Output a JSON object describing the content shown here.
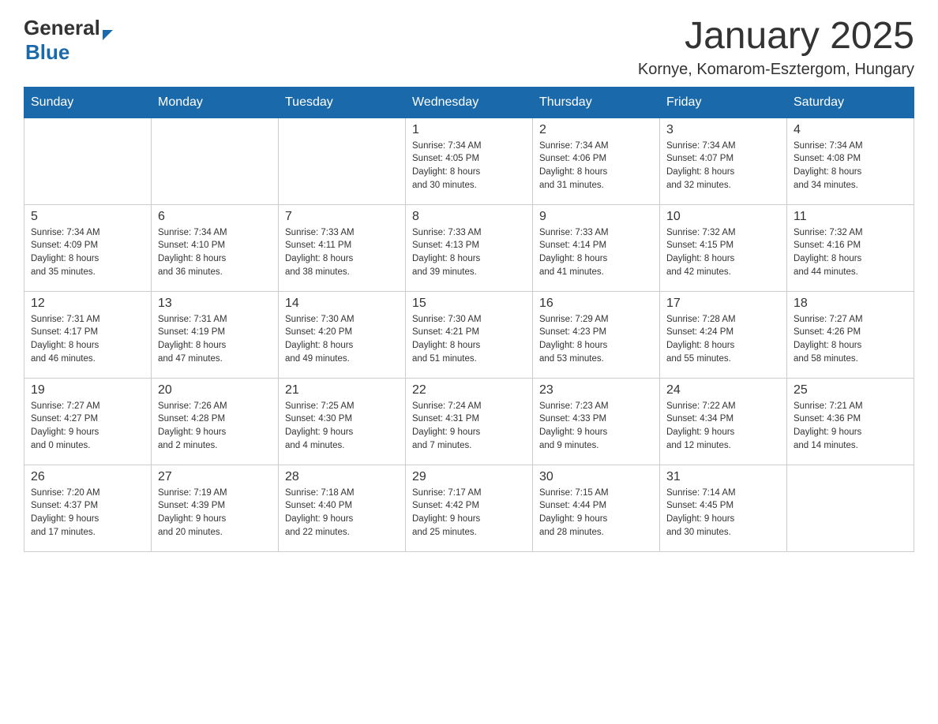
{
  "logo": {
    "general": "General",
    "blue": "Blue",
    "arrow_shape": "►"
  },
  "header": {
    "title": "January 2025",
    "subtitle": "Kornye, Komarom-Esztergom, Hungary"
  },
  "weekdays": [
    "Sunday",
    "Monday",
    "Tuesday",
    "Wednesday",
    "Thursday",
    "Friday",
    "Saturday"
  ],
  "weeks": [
    [
      {
        "day": "",
        "info": ""
      },
      {
        "day": "",
        "info": ""
      },
      {
        "day": "",
        "info": ""
      },
      {
        "day": "1",
        "info": "Sunrise: 7:34 AM\nSunset: 4:05 PM\nDaylight: 8 hours\nand 30 minutes."
      },
      {
        "day": "2",
        "info": "Sunrise: 7:34 AM\nSunset: 4:06 PM\nDaylight: 8 hours\nand 31 minutes."
      },
      {
        "day": "3",
        "info": "Sunrise: 7:34 AM\nSunset: 4:07 PM\nDaylight: 8 hours\nand 32 minutes."
      },
      {
        "day": "4",
        "info": "Sunrise: 7:34 AM\nSunset: 4:08 PM\nDaylight: 8 hours\nand 34 minutes."
      }
    ],
    [
      {
        "day": "5",
        "info": "Sunrise: 7:34 AM\nSunset: 4:09 PM\nDaylight: 8 hours\nand 35 minutes."
      },
      {
        "day": "6",
        "info": "Sunrise: 7:34 AM\nSunset: 4:10 PM\nDaylight: 8 hours\nand 36 minutes."
      },
      {
        "day": "7",
        "info": "Sunrise: 7:33 AM\nSunset: 4:11 PM\nDaylight: 8 hours\nand 38 minutes."
      },
      {
        "day": "8",
        "info": "Sunrise: 7:33 AM\nSunset: 4:13 PM\nDaylight: 8 hours\nand 39 minutes."
      },
      {
        "day": "9",
        "info": "Sunrise: 7:33 AM\nSunset: 4:14 PM\nDaylight: 8 hours\nand 41 minutes."
      },
      {
        "day": "10",
        "info": "Sunrise: 7:32 AM\nSunset: 4:15 PM\nDaylight: 8 hours\nand 42 minutes."
      },
      {
        "day": "11",
        "info": "Sunrise: 7:32 AM\nSunset: 4:16 PM\nDaylight: 8 hours\nand 44 minutes."
      }
    ],
    [
      {
        "day": "12",
        "info": "Sunrise: 7:31 AM\nSunset: 4:17 PM\nDaylight: 8 hours\nand 46 minutes."
      },
      {
        "day": "13",
        "info": "Sunrise: 7:31 AM\nSunset: 4:19 PM\nDaylight: 8 hours\nand 47 minutes."
      },
      {
        "day": "14",
        "info": "Sunrise: 7:30 AM\nSunset: 4:20 PM\nDaylight: 8 hours\nand 49 minutes."
      },
      {
        "day": "15",
        "info": "Sunrise: 7:30 AM\nSunset: 4:21 PM\nDaylight: 8 hours\nand 51 minutes."
      },
      {
        "day": "16",
        "info": "Sunrise: 7:29 AM\nSunset: 4:23 PM\nDaylight: 8 hours\nand 53 minutes."
      },
      {
        "day": "17",
        "info": "Sunrise: 7:28 AM\nSunset: 4:24 PM\nDaylight: 8 hours\nand 55 minutes."
      },
      {
        "day": "18",
        "info": "Sunrise: 7:27 AM\nSunset: 4:26 PM\nDaylight: 8 hours\nand 58 minutes."
      }
    ],
    [
      {
        "day": "19",
        "info": "Sunrise: 7:27 AM\nSunset: 4:27 PM\nDaylight: 9 hours\nand 0 minutes."
      },
      {
        "day": "20",
        "info": "Sunrise: 7:26 AM\nSunset: 4:28 PM\nDaylight: 9 hours\nand 2 minutes."
      },
      {
        "day": "21",
        "info": "Sunrise: 7:25 AM\nSunset: 4:30 PM\nDaylight: 9 hours\nand 4 minutes."
      },
      {
        "day": "22",
        "info": "Sunrise: 7:24 AM\nSunset: 4:31 PM\nDaylight: 9 hours\nand 7 minutes."
      },
      {
        "day": "23",
        "info": "Sunrise: 7:23 AM\nSunset: 4:33 PM\nDaylight: 9 hours\nand 9 minutes."
      },
      {
        "day": "24",
        "info": "Sunrise: 7:22 AM\nSunset: 4:34 PM\nDaylight: 9 hours\nand 12 minutes."
      },
      {
        "day": "25",
        "info": "Sunrise: 7:21 AM\nSunset: 4:36 PM\nDaylight: 9 hours\nand 14 minutes."
      }
    ],
    [
      {
        "day": "26",
        "info": "Sunrise: 7:20 AM\nSunset: 4:37 PM\nDaylight: 9 hours\nand 17 minutes."
      },
      {
        "day": "27",
        "info": "Sunrise: 7:19 AM\nSunset: 4:39 PM\nDaylight: 9 hours\nand 20 minutes."
      },
      {
        "day": "28",
        "info": "Sunrise: 7:18 AM\nSunset: 4:40 PM\nDaylight: 9 hours\nand 22 minutes."
      },
      {
        "day": "29",
        "info": "Sunrise: 7:17 AM\nSunset: 4:42 PM\nDaylight: 9 hours\nand 25 minutes."
      },
      {
        "day": "30",
        "info": "Sunrise: 7:15 AM\nSunset: 4:44 PM\nDaylight: 9 hours\nand 28 minutes."
      },
      {
        "day": "31",
        "info": "Sunrise: 7:14 AM\nSunset: 4:45 PM\nDaylight: 9 hours\nand 30 minutes."
      },
      {
        "day": "",
        "info": ""
      }
    ]
  ]
}
